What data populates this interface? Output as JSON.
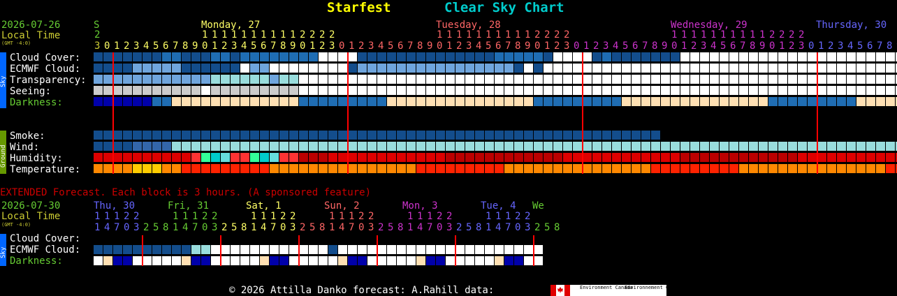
{
  "title": {
    "site": "Starfest",
    "chart": "Clear Sky Chart",
    "site_color": "#ffff00",
    "chart_color": "#00cccc"
  },
  "header": {
    "date": "2026-07-26",
    "local_time": "Local Time",
    "gmt": "(GMT -4:0)"
  },
  "day_labels": [
    {
      "text": "S",
      "color": "#66cc33"
    },
    {
      "text": "Monday, 27",
      "color": "#ffff66"
    },
    {
      "text": "Tuesday, 28",
      "color": "#ff6666"
    },
    {
      "text": "Wednesday, 29",
      "color": "#cc33cc"
    },
    {
      "text": "Thursday, 30",
      "color": "#6666ff"
    }
  ],
  "side_labels": {
    "sky": "Sky",
    "ground": "Ground"
  },
  "hours": [
    3,
    0,
    1,
    2,
    3,
    4,
    5,
    6,
    7,
    8,
    9,
    0,
    1,
    2,
    3,
    4,
    5,
    6,
    7,
    8,
    9,
    0,
    1,
    2,
    3,
    0,
    1,
    2,
    3,
    4,
    5,
    6,
    7,
    8,
    9,
    0,
    1,
    2,
    3,
    4,
    5,
    6,
    7,
    8,
    9,
    0,
    1,
    2,
    3,
    0,
    1,
    2,
    3,
    4,
    5,
    6,
    7,
    8,
    9,
    0,
    1,
    2,
    3,
    4,
    5,
    6,
    7,
    8,
    9,
    0,
    1,
    2,
    3,
    0,
    1,
    2,
    3,
    4,
    5,
    6,
    7,
    8,
    9,
    0,
    1,
    2,
    3,
    4,
    5,
    6,
    7,
    8,
    9,
    0,
    1,
    2,
    3,
    0,
    1,
    2,
    3,
    4,
    5,
    6,
    7,
    8
  ],
  "hours_tens": [
    "2",
    "",
    "",
    "",
    "",
    "",
    "",
    "",
    "",
    "",
    "",
    "1",
    "1",
    "1",
    "1",
    "1",
    "1",
    "1",
    "1",
    "1",
    "1",
    "2",
    "2",
    "2",
    "2",
    "",
    "",
    "",
    "",
    "",
    "",
    "",
    "",
    "",
    "",
    "1",
    "1",
    "1",
    "1",
    "1",
    "1",
    "1",
    "1",
    "1",
    "1",
    "2",
    "2",
    "2",
    "2",
    "",
    "",
    "",
    "",
    "",
    "",
    "",
    "",
    "",
    "",
    "1",
    "1",
    "1",
    "1",
    "1",
    "1",
    "1",
    "1",
    "1",
    "1",
    "2",
    "2",
    "2",
    "2",
    "",
    "",
    "",
    "",
    "",
    "",
    "",
    "",
    "",
    "",
    "",
    "",
    "",
    "",
    "",
    "",
    "",
    "",
    "",
    "",
    "",
    "",
    "",
    "",
    "",
    "",
    "",
    "",
    "",
    "",
    "",
    "",
    "",
    "",
    "",
    "",
    ""
  ],
  "sky_rows": [
    "Cloud Cover:",
    "ECMWF Cloud:",
    "Transparency:",
    "Seeing:",
    "Darkness:"
  ],
  "ground_rows": [
    "Smoke:",
    "Wind:",
    "Humidity:",
    "Temperature:"
  ],
  "extended": {
    "banner": "EXTENDED Forecast. Each block is 3 hours. (A sponsored feature)",
    "date": "2026-07-30",
    "local_time": "Local Time",
    "gmt": "(GMT -4:0)",
    "day_labels": [
      {
        "text": "Thu, 30",
        "color": "#6666ff"
      },
      {
        "text": "Fri, 31",
        "color": "#66cc33"
      },
      {
        "text": "Sat, 1",
        "color": "#ffff66"
      },
      {
        "text": "Sun, 2",
        "color": "#ff6666"
      },
      {
        "text": "Mon, 3",
        "color": "#cc33cc"
      },
      {
        "text": "Tue, 4",
        "color": "#6666ff"
      },
      {
        "text": "We",
        "color": "#66cc33"
      }
    ],
    "tens": [
      "1",
      "1",
      "1",
      "2",
      "2",
      "",
      "",
      "",
      "1",
      "1",
      "1",
      "2",
      "2",
      "",
      "",
      "",
      "1",
      "1",
      "1",
      "2",
      "2",
      "",
      "",
      "",
      "1",
      "1",
      "1",
      "2",
      "2",
      "",
      "",
      "",
      "1",
      "1",
      "1",
      "2",
      "2",
      "",
      "",
      "",
      "1",
      "1",
      "1",
      "2",
      "2",
      "",
      "",
      "",
      "",
      ""
    ],
    "ones": [
      "1",
      "4",
      "7",
      "0",
      "3",
      "2",
      "5",
      "8",
      "1",
      "4",
      "7",
      "0",
      "3",
      "2",
      "5",
      "8",
      "1",
      "4",
      "7",
      "0",
      "3",
      "2",
      "5",
      "8",
      "1",
      "4",
      "7",
      "0",
      "3",
      "2",
      "5",
      "8",
      "1",
      "4",
      "7",
      "0",
      "3",
      "2",
      "5",
      "8",
      "1",
      "4",
      "7",
      "0",
      "3",
      "2",
      "5",
      "8"
    ],
    "rows": [
      "Cloud Cover:",
      "ECMWF Cloud:",
      "Darkness:"
    ]
  },
  "footer": {
    "text": "© 2026 Attilla Danko  forecast: A.Rahill  data:",
    "logo_en": "Environment Canada",
    "logo_fr": "Environnement Canada"
  },
  "colors": {
    "row_label": "#ffffff",
    "darkness_label": "#66cc33",
    "date": "#66cc33",
    "local_time": "#cccc33",
    "midnight_line": "#ff0000",
    "banner": "#cc0000",
    "sky_bar": "#0066ff",
    "ground_bar": "#669900"
  },
  "chart_data": {
    "type": "heatmap",
    "main": {
      "first_hour": 23,
      "block_hours": 1,
      "midnight_columns": [
        1,
        25,
        49,
        73
      ],
      "cloud_cover": "1111111221112212222222200001111111111111122222100001211111110000000000000000000000000000000000001110000",
      "ecmwf_cloud": "1111222221111110220000000012222222222222222101000000000000000000000000000000000000000000000000000000000",
      "transparency": "2222222222223333332330000000000000000000000000000000000000000000000000000000000000000000000000000000000",
      "seeing": "3333333333343333333330000000000000000000000000000000000000000000000000000000000000000000000000000000000",
      "darkness": "1111211133333333333333333333333333333333333333333333333333333333333333333333333333333333333333333333333",
      "smoke": "1111111111111111111111111111111111111111111111111111111111",
      "wind": "1111222233333333333333333333333333333333333333333333333333333333333333333333333333333333333333333333333",
      "humidity": "1111111111111111111111111111111111111111111111111111111111111111111111111111111111111111111111111111111",
      "temperature": "1111111111111111111111111111111111111111111111111111111111111111111111111111111111111111111111111111111"
    },
    "extended": {
      "block_hours": 3,
      "midnight_columns": [
        5,
        13,
        21,
        29,
        37,
        45
      ],
      "cloud_cover": "0000000000000000000000000000000000000000000000",
      "ecmwf_cloud": "1111111111221100000000001000000000000000000000",
      "darkness": "1111111111111111111111111111111111111111111111"
    }
  }
}
